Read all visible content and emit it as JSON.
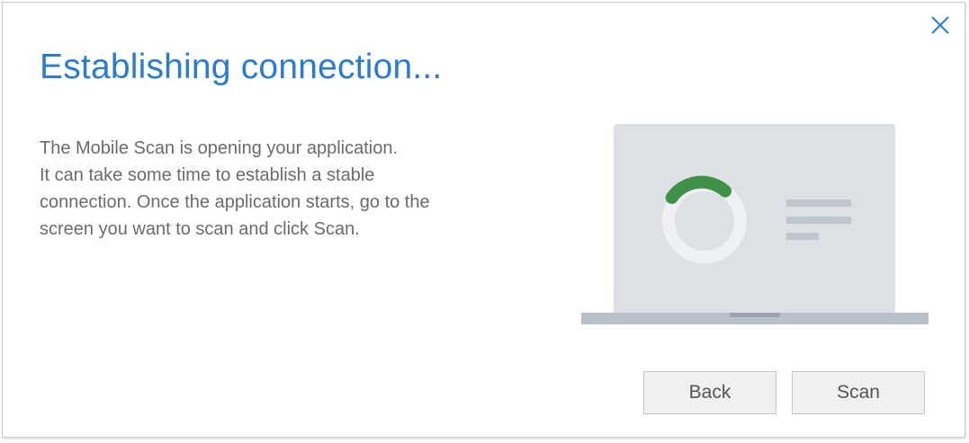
{
  "dialog": {
    "title": "Establishing connection...",
    "description_lines": [
      "The Mobile Scan is opening your application.",
      "It can take some time to establish a stable",
      "connection. Once the application starts, go to the",
      "screen you want to scan and click Scan."
    ],
    "close_icon": "close-icon",
    "illustration_icon": "laptop-loading-icon",
    "buttons": {
      "back_label": "Back",
      "scan_label": "Scan"
    }
  },
  "colors": {
    "title": "#2a7bd4",
    "spinner_progress": "#3f9147",
    "laptop_screen": "#dde1e6",
    "laptop_base": "#b9c0c8"
  }
}
